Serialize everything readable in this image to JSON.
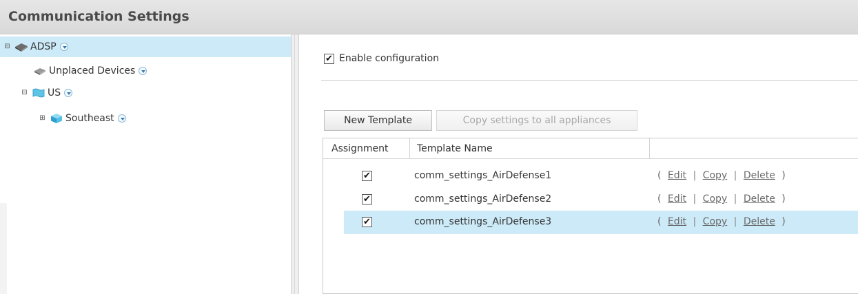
{
  "header": {
    "title": "Communication Settings"
  },
  "tree": {
    "nodes": [
      {
        "label": "ADSP",
        "expander": "⊟",
        "selected": true
      },
      {
        "label": "Unplaced Devices"
      },
      {
        "label": "US",
        "expander": "⊟"
      },
      {
        "label": "Southeast",
        "expander": "⊞"
      }
    ]
  },
  "settings": {
    "enable_label": "Enable configuration",
    "enable_checked": true
  },
  "toolbar": {
    "new_template": "New Template",
    "copy_settings": "Copy settings to all appliances"
  },
  "table": {
    "headers": [
      "Assignment",
      "Template Name",
      ""
    ],
    "actions": {
      "open": "(",
      "edit": "Edit",
      "sep": "|",
      "copy": "Copy",
      "delete": "Delete",
      "close": ")"
    },
    "rows": [
      {
        "assigned": true,
        "name": "comm_settings_AirDefense1"
      },
      {
        "assigned": true,
        "name": "comm_settings_AirDefense2"
      },
      {
        "assigned": true,
        "name": "comm_settings_AirDefense3",
        "selected": true
      }
    ]
  },
  "colors": {
    "selection": "#cceaf7",
    "title_bg": "#dcdcdc"
  },
  "icons": [
    "appliance-icon",
    "device-icon",
    "region-icon",
    "cube-icon",
    "dropdown-icon",
    "checkbox-icon"
  ]
}
